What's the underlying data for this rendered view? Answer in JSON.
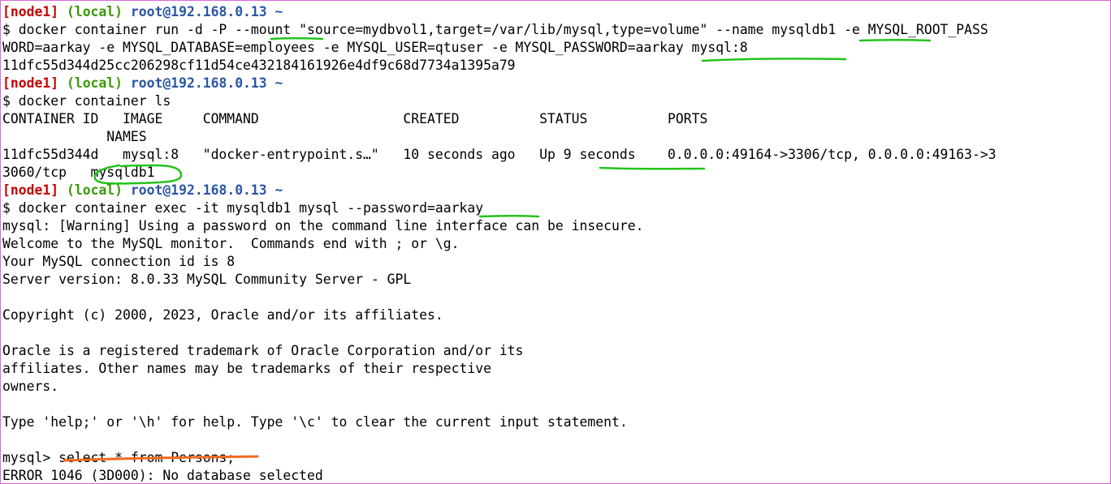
{
  "colors": {
    "prompt_node": "#c80000",
    "prompt_local": "#3a9a00",
    "prompt_host": "#2a55a5",
    "annotation_green": "#22c41a",
    "annotation_orange": "#f06a1e",
    "frame": "#d86bd8"
  },
  "prompt": {
    "node": "[node1]",
    "local": "(local)",
    "host": "root@192.168.0.13 ~"
  },
  "lines": [
    "$ docker container run -d -P --mount \"source=mydbvol1,target=/var/lib/mysql,type=volume\" --name mysqldb1 -e MYSQL_ROOT_PASS",
    "WORD=aarkay -e MYSQL_DATABASE=employees -e MYSQL_USER=qtuser -e MYSQL_PASSWORD=aarkay mysql:8",
    "11dfc55d344d25cc206298cf11d54ce432184161926e4df9c68d7734a1395a79",
    "$ docker container ls",
    "CONTAINER ID   IMAGE     COMMAND                  CREATED          STATUS          PORTS",
    "             NAMES",
    "11dfc55d344d   mysql:8   \"docker-entrypoint.s…\"   10 seconds ago   Up 9 seconds    0.0.0.0:49164->3306/tcp, 0.0.0.0:49163->3",
    "3060/tcp   mysqldb1",
    "$ docker container exec -it mysqldb1 mysql --password=aarkay",
    "mysql: [Warning] Using a password on the command line interface can be insecure.",
    "Welcome to the MySQL monitor.  Commands end with ; or \\g.",
    "Your MySQL connection id is 8",
    "Server version: 8.0.33 MySQL Community Server - GPL",
    "",
    "Copyright (c) 2000, 2023, Oracle and/or its affiliates.",
    "",
    "Oracle is a registered trademark of Oracle Corporation and/or its",
    "affiliates. Other names may be trademarks of their respective",
    "owners.",
    "",
    "Type 'help;' or '\\h' for help. Type '\\c' to clear the current input statement.",
    "",
    "mysql> select * from Persons;",
    "ERROR 1046 (3D000): No database selected"
  ]
}
